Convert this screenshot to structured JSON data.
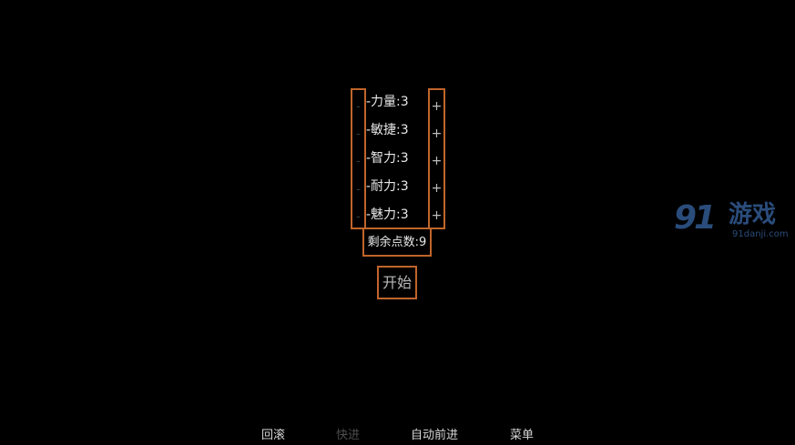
{
  "stats": [
    {
      "minus": "-",
      "label": "-力量:3",
      "plus": "+"
    },
    {
      "minus": "-",
      "label": "-敏捷:3",
      "plus": "+"
    },
    {
      "minus": "-",
      "label": "-智力:3",
      "plus": "+"
    },
    {
      "minus": "-",
      "label": "-耐力:3",
      "plus": "+"
    },
    {
      "minus": "-",
      "label": "-魅力:3",
      "plus": "+"
    }
  ],
  "remaining": "剩余点数:9",
  "start_label": "开始",
  "bottom_menu": [
    "回滚",
    "快进",
    "自动前进",
    "菜单"
  ],
  "watermark": {
    "logo": "91",
    "name": "游戏",
    "url": "91danji.com"
  },
  "colors": {
    "accent": "#c0652a",
    "background": "#000000",
    "watermark": "#3d6db0"
  }
}
